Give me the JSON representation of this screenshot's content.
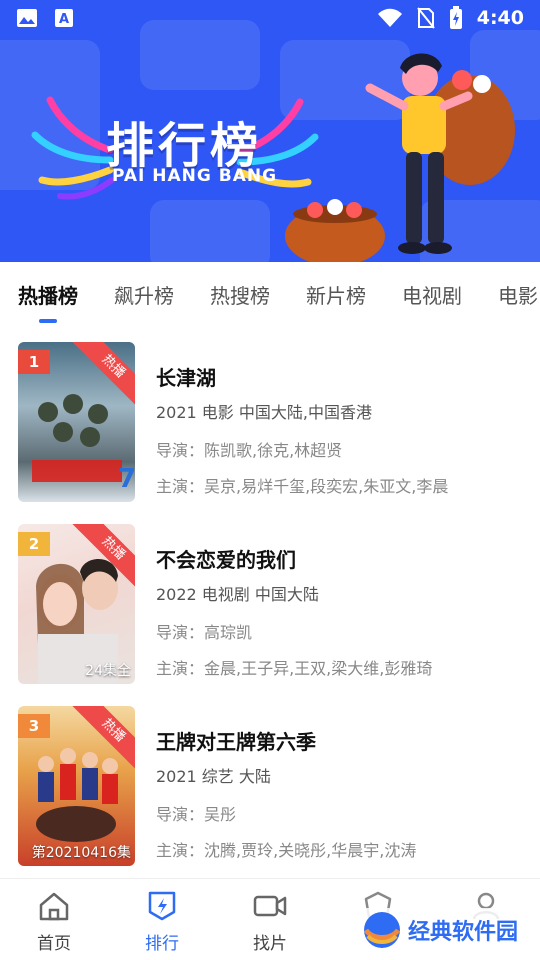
{
  "status": {
    "time": "4:40"
  },
  "banner": {
    "title": "排行榜",
    "subtitle": "PAI HANG BANG"
  },
  "tabs": [
    "热播榜",
    "飙升榜",
    "热搜榜",
    "新片榜",
    "电视剧",
    "电影"
  ],
  "items": [
    {
      "rank": "1",
      "hot_label": "热播",
      "caption": "",
      "title": "长津湖",
      "meta": "2021  电影  中国大陆,中国香港",
      "director": "导演：陈凯歌,徐克,林超贤",
      "cast": "主演：吴京,易烊千玺,段奕宏,朱亚文,李晨"
    },
    {
      "rank": "2",
      "hot_label": "热播",
      "caption": "24集全",
      "title": "不会恋爱的我们",
      "meta": "2022  电视剧  中国大陆",
      "director": "导演：高琮凯",
      "cast": "主演：金晨,王子异,王双,梁大维,彭雅琦"
    },
    {
      "rank": "3",
      "hot_label": "热播",
      "caption": "第20210416集",
      "title": "王牌对王牌第六季",
      "meta": "2021  综艺  大陆",
      "director": "导演：吴彤",
      "cast": "主演：沈腾,贾玲,关晓彤,华晨宇,沈涛"
    }
  ],
  "nav": [
    "首页",
    "排行",
    "找片",
    "",
    ""
  ],
  "watermark": "经典软件园",
  "colors": {
    "accent": "#2f6cf4",
    "banner": "#2f57f5",
    "hot": "#ef4a4a"
  }
}
